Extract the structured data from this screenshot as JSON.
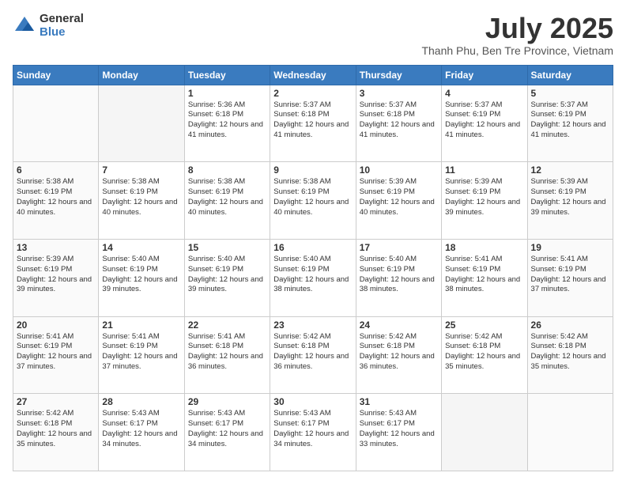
{
  "header": {
    "logo_general": "General",
    "logo_blue": "Blue",
    "title": "July 2025",
    "subtitle": "Thanh Phu, Ben Tre Province, Vietnam"
  },
  "weekdays": [
    "Sunday",
    "Monday",
    "Tuesday",
    "Wednesday",
    "Thursday",
    "Friday",
    "Saturday"
  ],
  "weeks": [
    [
      {
        "day": "",
        "info": ""
      },
      {
        "day": "",
        "info": ""
      },
      {
        "day": "1",
        "info": "Sunrise: 5:36 AM\nSunset: 6:18 PM\nDaylight: 12 hours and 41 minutes."
      },
      {
        "day": "2",
        "info": "Sunrise: 5:37 AM\nSunset: 6:18 PM\nDaylight: 12 hours and 41 minutes."
      },
      {
        "day": "3",
        "info": "Sunrise: 5:37 AM\nSunset: 6:18 PM\nDaylight: 12 hours and 41 minutes."
      },
      {
        "day": "4",
        "info": "Sunrise: 5:37 AM\nSunset: 6:19 PM\nDaylight: 12 hours and 41 minutes."
      },
      {
        "day": "5",
        "info": "Sunrise: 5:37 AM\nSunset: 6:19 PM\nDaylight: 12 hours and 41 minutes."
      }
    ],
    [
      {
        "day": "6",
        "info": "Sunrise: 5:38 AM\nSunset: 6:19 PM\nDaylight: 12 hours and 40 minutes."
      },
      {
        "day": "7",
        "info": "Sunrise: 5:38 AM\nSunset: 6:19 PM\nDaylight: 12 hours and 40 minutes."
      },
      {
        "day": "8",
        "info": "Sunrise: 5:38 AM\nSunset: 6:19 PM\nDaylight: 12 hours and 40 minutes."
      },
      {
        "day": "9",
        "info": "Sunrise: 5:38 AM\nSunset: 6:19 PM\nDaylight: 12 hours and 40 minutes."
      },
      {
        "day": "10",
        "info": "Sunrise: 5:39 AM\nSunset: 6:19 PM\nDaylight: 12 hours and 40 minutes."
      },
      {
        "day": "11",
        "info": "Sunrise: 5:39 AM\nSunset: 6:19 PM\nDaylight: 12 hours and 39 minutes."
      },
      {
        "day": "12",
        "info": "Sunrise: 5:39 AM\nSunset: 6:19 PM\nDaylight: 12 hours and 39 minutes."
      }
    ],
    [
      {
        "day": "13",
        "info": "Sunrise: 5:39 AM\nSunset: 6:19 PM\nDaylight: 12 hours and 39 minutes."
      },
      {
        "day": "14",
        "info": "Sunrise: 5:40 AM\nSunset: 6:19 PM\nDaylight: 12 hours and 39 minutes."
      },
      {
        "day": "15",
        "info": "Sunrise: 5:40 AM\nSunset: 6:19 PM\nDaylight: 12 hours and 39 minutes."
      },
      {
        "day": "16",
        "info": "Sunrise: 5:40 AM\nSunset: 6:19 PM\nDaylight: 12 hours and 38 minutes."
      },
      {
        "day": "17",
        "info": "Sunrise: 5:40 AM\nSunset: 6:19 PM\nDaylight: 12 hours and 38 minutes."
      },
      {
        "day": "18",
        "info": "Sunrise: 5:41 AM\nSunset: 6:19 PM\nDaylight: 12 hours and 38 minutes."
      },
      {
        "day": "19",
        "info": "Sunrise: 5:41 AM\nSunset: 6:19 PM\nDaylight: 12 hours and 37 minutes."
      }
    ],
    [
      {
        "day": "20",
        "info": "Sunrise: 5:41 AM\nSunset: 6:19 PM\nDaylight: 12 hours and 37 minutes."
      },
      {
        "day": "21",
        "info": "Sunrise: 5:41 AM\nSunset: 6:19 PM\nDaylight: 12 hours and 37 minutes."
      },
      {
        "day": "22",
        "info": "Sunrise: 5:41 AM\nSunset: 6:18 PM\nDaylight: 12 hours and 36 minutes."
      },
      {
        "day": "23",
        "info": "Sunrise: 5:42 AM\nSunset: 6:18 PM\nDaylight: 12 hours and 36 minutes."
      },
      {
        "day": "24",
        "info": "Sunrise: 5:42 AM\nSunset: 6:18 PM\nDaylight: 12 hours and 36 minutes."
      },
      {
        "day": "25",
        "info": "Sunrise: 5:42 AM\nSunset: 6:18 PM\nDaylight: 12 hours and 35 minutes."
      },
      {
        "day": "26",
        "info": "Sunrise: 5:42 AM\nSunset: 6:18 PM\nDaylight: 12 hours and 35 minutes."
      }
    ],
    [
      {
        "day": "27",
        "info": "Sunrise: 5:42 AM\nSunset: 6:18 PM\nDaylight: 12 hours and 35 minutes."
      },
      {
        "day": "28",
        "info": "Sunrise: 5:43 AM\nSunset: 6:17 PM\nDaylight: 12 hours and 34 minutes."
      },
      {
        "day": "29",
        "info": "Sunrise: 5:43 AM\nSunset: 6:17 PM\nDaylight: 12 hours and 34 minutes."
      },
      {
        "day": "30",
        "info": "Sunrise: 5:43 AM\nSunset: 6:17 PM\nDaylight: 12 hours and 34 minutes."
      },
      {
        "day": "31",
        "info": "Sunrise: 5:43 AM\nSunset: 6:17 PM\nDaylight: 12 hours and 33 minutes."
      },
      {
        "day": "",
        "info": ""
      },
      {
        "day": "",
        "info": ""
      }
    ]
  ]
}
